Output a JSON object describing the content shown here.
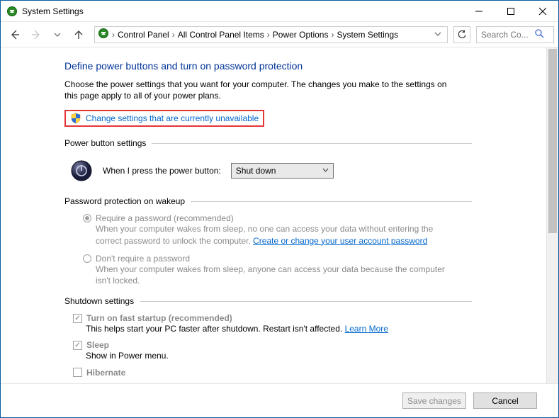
{
  "titlebar": {
    "title": "System Settings"
  },
  "breadcrumbs": {
    "items": [
      "Control Panel",
      "All Control Panel Items",
      "Power Options",
      "System Settings"
    ]
  },
  "search": {
    "placeholder": "Search Co..."
  },
  "main": {
    "heading": "Define power buttons and turn on password protection",
    "subtext": "Choose the power settings that you want for your computer. The changes you make to the settings on this page apply to all of your power plans.",
    "change_link": "Change settings that are currently unavailable"
  },
  "sections": {
    "power_button": {
      "title": "Power button settings",
      "label": "When I press the power button:",
      "dropdown_value": "Shut down"
    },
    "password": {
      "title": "Password protection on wakeup",
      "options": [
        {
          "label": "Require a password (recommended)",
          "desc_pre": "When your computer wakes from sleep, no one can access your data without entering the correct password to unlock the computer. ",
          "link": "Create or change your user account password",
          "selected": true
        },
        {
          "label": "Don't require a password",
          "desc_pre": "When your computer wakes from sleep, anyone can access your data because the computer isn't locked.",
          "link": "",
          "selected": false
        }
      ]
    },
    "shutdown": {
      "title": "Shutdown settings",
      "items": [
        {
          "label": "Turn on fast startup (recommended)",
          "desc": "This helps start your PC faster after shutdown. Restart isn't affected. ",
          "link": "Learn More",
          "checked": true
        },
        {
          "label": "Sleep",
          "desc": "Show in Power menu.",
          "link": "",
          "checked": true
        },
        {
          "label": "Hibernate",
          "desc": "",
          "link": "",
          "checked": false
        }
      ]
    }
  },
  "footer": {
    "save": "Save changes",
    "cancel": "Cancel"
  }
}
